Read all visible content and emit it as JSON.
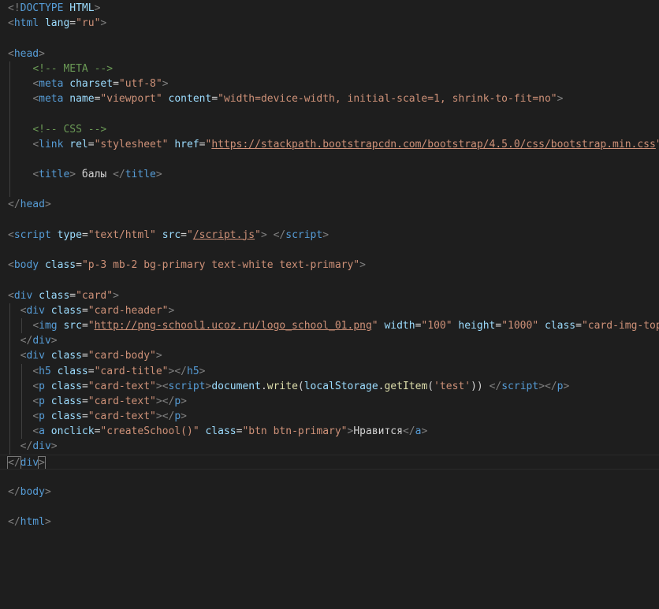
{
  "theme": {
    "background": "#1e1e1e",
    "colors": {
      "tag": "#569cd6",
      "attr": "#9cdcfe",
      "str": "#ce9178",
      "punc": "#808080",
      "text": "#d4d4d4",
      "comment": "#6a9955",
      "func": "#dcdcaa"
    }
  },
  "editor": {
    "active_line_index": 30,
    "lines": [
      {
        "guides": 0,
        "tokens": [
          [
            "punc",
            "<!"
          ],
          [
            "tag",
            "DOCTYPE"
          ],
          [
            "text",
            " "
          ],
          [
            "attr",
            "HTML"
          ],
          [
            "punc",
            ">"
          ]
        ]
      },
      {
        "guides": 0,
        "tokens": [
          [
            "punc",
            "<"
          ],
          [
            "tag",
            "html"
          ],
          [
            "text",
            " "
          ],
          [
            "attr",
            "lang"
          ],
          [
            "text",
            "="
          ],
          [
            "str",
            "\"ru\""
          ],
          [
            "punc",
            ">"
          ]
        ]
      },
      {
        "guides": 0,
        "tokens": []
      },
      {
        "guides": 0,
        "tokens": [
          [
            "punc",
            "<"
          ],
          [
            "tag",
            "head"
          ],
          [
            "punc",
            ">"
          ]
        ]
      },
      {
        "guides": 1,
        "tokens": [
          [
            "text",
            "    "
          ],
          [
            "comment",
            "<!-- META -->"
          ]
        ]
      },
      {
        "guides": 1,
        "tokens": [
          [
            "text",
            "    "
          ],
          [
            "punc",
            "<"
          ],
          [
            "tag",
            "meta"
          ],
          [
            "text",
            " "
          ],
          [
            "attr",
            "charset"
          ],
          [
            "text",
            "="
          ],
          [
            "str",
            "\"utf-8\""
          ],
          [
            "punc",
            ">"
          ]
        ]
      },
      {
        "guides": 1,
        "tokens": [
          [
            "text",
            "    "
          ],
          [
            "punc",
            "<"
          ],
          [
            "tag",
            "meta"
          ],
          [
            "text",
            " "
          ],
          [
            "attr",
            "name"
          ],
          [
            "text",
            "="
          ],
          [
            "str",
            "\"viewport\""
          ],
          [
            "text",
            " "
          ],
          [
            "attr",
            "content"
          ],
          [
            "text",
            "="
          ],
          [
            "str",
            "\"width=device-width, initial-scale=1, shrink-to-fit=no\""
          ],
          [
            "punc",
            ">"
          ]
        ]
      },
      {
        "guides": 1,
        "tokens": []
      },
      {
        "guides": 1,
        "tokens": [
          [
            "text",
            "    "
          ],
          [
            "comment",
            "<!-- CSS -->"
          ]
        ]
      },
      {
        "guides": 1,
        "tokens": [
          [
            "text",
            "    "
          ],
          [
            "punc",
            "<"
          ],
          [
            "tag",
            "link"
          ],
          [
            "text",
            " "
          ],
          [
            "attr",
            "rel"
          ],
          [
            "text",
            "="
          ],
          [
            "str",
            "\"stylesheet\""
          ],
          [
            "text",
            " "
          ],
          [
            "attr",
            "href"
          ],
          [
            "text",
            "="
          ],
          [
            "str",
            "\""
          ],
          [
            "str link",
            "https://stackpath.bootstrapcdn.com/bootstrap/4.5.0/css/bootstrap.min.css"
          ],
          [
            "str",
            "\""
          ],
          [
            "text",
            " >"
          ]
        ]
      },
      {
        "guides": 1,
        "tokens": []
      },
      {
        "guides": 1,
        "tokens": [
          [
            "text",
            "    "
          ],
          [
            "punc",
            "<"
          ],
          [
            "tag",
            "title"
          ],
          [
            "punc",
            ">"
          ],
          [
            "text",
            " балы "
          ],
          [
            "punc",
            "</"
          ],
          [
            "tag",
            "title"
          ],
          [
            "punc",
            ">"
          ]
        ]
      },
      {
        "guides": 1,
        "tokens": []
      },
      {
        "guides": 0,
        "tokens": [
          [
            "punc",
            "</"
          ],
          [
            "tag",
            "head"
          ],
          [
            "punc",
            ">"
          ]
        ]
      },
      {
        "guides": 0,
        "tokens": []
      },
      {
        "guides": 0,
        "tokens": [
          [
            "punc",
            "<"
          ],
          [
            "tag",
            "script"
          ],
          [
            "text",
            " "
          ],
          [
            "attr",
            "type"
          ],
          [
            "text",
            "="
          ],
          [
            "str",
            "\"text/html\""
          ],
          [
            "text",
            " "
          ],
          [
            "attr",
            "src"
          ],
          [
            "text",
            "="
          ],
          [
            "str",
            "\""
          ],
          [
            "str link",
            "/script.js"
          ],
          [
            "str",
            "\""
          ],
          [
            "punc",
            ">"
          ],
          [
            "text",
            " "
          ],
          [
            "punc",
            "</"
          ],
          [
            "tag",
            "script"
          ],
          [
            "punc",
            ">"
          ]
        ]
      },
      {
        "guides": 0,
        "tokens": []
      },
      {
        "guides": 0,
        "tokens": [
          [
            "punc",
            "<"
          ],
          [
            "tag",
            "body"
          ],
          [
            "text",
            " "
          ],
          [
            "attr",
            "class"
          ],
          [
            "text",
            "="
          ],
          [
            "str",
            "\"p-3 mb-2 bg-primary text-white text-primary\""
          ],
          [
            "punc",
            ">"
          ]
        ]
      },
      {
        "guides": 0,
        "tokens": []
      },
      {
        "guides": 0,
        "tokens": [
          [
            "punc",
            "<"
          ],
          [
            "tag",
            "div"
          ],
          [
            "text",
            " "
          ],
          [
            "attr",
            "class"
          ],
          [
            "text",
            "="
          ],
          [
            "str",
            "\"card\""
          ],
          [
            "punc",
            ">"
          ]
        ]
      },
      {
        "guides": 1,
        "tokens": [
          [
            "text",
            "  "
          ],
          [
            "punc",
            "<"
          ],
          [
            "tag",
            "div"
          ],
          [
            "text",
            " "
          ],
          [
            "attr",
            "class"
          ],
          [
            "text",
            "="
          ],
          [
            "str",
            "\"card-header\""
          ],
          [
            "punc",
            ">"
          ]
        ]
      },
      {
        "guides": 2,
        "tokens": [
          [
            "text",
            "    "
          ],
          [
            "punc",
            "<"
          ],
          [
            "tag",
            "img"
          ],
          [
            "text",
            " "
          ],
          [
            "attr",
            "src"
          ],
          [
            "text",
            "="
          ],
          [
            "str",
            "\""
          ],
          [
            "str link",
            "http://png-school1.ucoz.ru/logo_school_01.png"
          ],
          [
            "str",
            "\""
          ],
          [
            "text",
            " "
          ],
          [
            "attr",
            "width"
          ],
          [
            "text",
            "="
          ],
          [
            "str",
            "\"100\""
          ],
          [
            "text",
            " "
          ],
          [
            "attr",
            "height"
          ],
          [
            "text",
            "="
          ],
          [
            "str",
            "\"1000\""
          ],
          [
            "text",
            " "
          ],
          [
            "attr",
            "class"
          ],
          [
            "text",
            "="
          ],
          [
            "str",
            "\"card-img-top\""
          ],
          [
            "text",
            " >"
          ]
        ]
      },
      {
        "guides": 1,
        "tokens": [
          [
            "text",
            "  "
          ],
          [
            "punc",
            "</"
          ],
          [
            "tag",
            "div"
          ],
          [
            "punc",
            ">"
          ]
        ]
      },
      {
        "guides": 1,
        "tokens": [
          [
            "text",
            "  "
          ],
          [
            "punc",
            "<"
          ],
          [
            "tag",
            "div"
          ],
          [
            "text",
            " "
          ],
          [
            "attr",
            "class"
          ],
          [
            "text",
            "="
          ],
          [
            "str",
            "\"card-body\""
          ],
          [
            "punc",
            ">"
          ]
        ]
      },
      {
        "guides": 2,
        "tokens": [
          [
            "text",
            "    "
          ],
          [
            "punc",
            "<"
          ],
          [
            "tag",
            "h5"
          ],
          [
            "text",
            " "
          ],
          [
            "attr",
            "class"
          ],
          [
            "text",
            "="
          ],
          [
            "str",
            "\"card-title\""
          ],
          [
            "punc",
            ">"
          ],
          [
            "punc",
            "</"
          ],
          [
            "tag",
            "h5"
          ],
          [
            "punc",
            ">"
          ]
        ]
      },
      {
        "guides": 2,
        "tokens": [
          [
            "text",
            "    "
          ],
          [
            "punc",
            "<"
          ],
          [
            "tag",
            "p"
          ],
          [
            "text",
            " "
          ],
          [
            "attr",
            "class"
          ],
          [
            "text",
            "="
          ],
          [
            "str",
            "\"card-text\""
          ],
          [
            "punc",
            ">"
          ],
          [
            "punc",
            "<"
          ],
          [
            "tag",
            "script"
          ],
          [
            "punc",
            ">"
          ],
          [
            "attr",
            "document"
          ],
          [
            "text",
            "."
          ],
          [
            "func",
            "write"
          ],
          [
            "text",
            "("
          ],
          [
            "attr",
            "localStorage"
          ],
          [
            "text",
            "."
          ],
          [
            "func",
            "getItem"
          ],
          [
            "text",
            "("
          ],
          [
            "str",
            "'test'"
          ],
          [
            "text",
            "))"
          ],
          [
            "text",
            " "
          ],
          [
            "punc",
            "</"
          ],
          [
            "tag",
            "script"
          ],
          [
            "punc",
            ">"
          ],
          [
            "punc",
            "</"
          ],
          [
            "tag",
            "p"
          ],
          [
            "punc",
            ">"
          ]
        ]
      },
      {
        "guides": 2,
        "tokens": [
          [
            "text",
            "    "
          ],
          [
            "punc",
            "<"
          ],
          [
            "tag",
            "p"
          ],
          [
            "text",
            " "
          ],
          [
            "attr",
            "class"
          ],
          [
            "text",
            "="
          ],
          [
            "str",
            "\"card-text\""
          ],
          [
            "punc",
            ">"
          ],
          [
            "punc",
            "</"
          ],
          [
            "tag",
            "p"
          ],
          [
            "punc",
            ">"
          ]
        ]
      },
      {
        "guides": 2,
        "tokens": [
          [
            "text",
            "    "
          ],
          [
            "punc",
            "<"
          ],
          [
            "tag",
            "p"
          ],
          [
            "text",
            " "
          ],
          [
            "attr",
            "class"
          ],
          [
            "text",
            "="
          ],
          [
            "str",
            "\"card-text\""
          ],
          [
            "punc",
            ">"
          ],
          [
            "punc",
            "</"
          ],
          [
            "tag",
            "p"
          ],
          [
            "punc",
            ">"
          ]
        ]
      },
      {
        "guides": 2,
        "tokens": [
          [
            "text",
            "    "
          ],
          [
            "punc",
            "<"
          ],
          [
            "tag",
            "a"
          ],
          [
            "text",
            " "
          ],
          [
            "attr",
            "onclick"
          ],
          [
            "text",
            "="
          ],
          [
            "str",
            "\"createSchool()\""
          ],
          [
            "text",
            " "
          ],
          [
            "attr",
            "class"
          ],
          [
            "text",
            "="
          ],
          [
            "str",
            "\"btn btn-primary\""
          ],
          [
            "punc",
            ">"
          ],
          [
            "text",
            "Нравится"
          ],
          [
            "punc",
            "</"
          ],
          [
            "tag",
            "a"
          ],
          [
            "punc",
            ">"
          ]
        ]
      },
      {
        "guides": 1,
        "tokens": [
          [
            "text",
            "  "
          ],
          [
            "punc",
            "</"
          ],
          [
            "tag",
            "div"
          ],
          [
            "punc",
            ">"
          ]
        ]
      },
      {
        "guides": 0,
        "tokens": [
          [
            "punc bracket",
            "</"
          ],
          [
            "tag",
            "div"
          ],
          [
            "punc bracket",
            ">"
          ]
        ]
      },
      {
        "guides": 0,
        "tokens": []
      },
      {
        "guides": 0,
        "tokens": [
          [
            "punc",
            "</"
          ],
          [
            "tag",
            "body"
          ],
          [
            "punc",
            ">"
          ]
        ]
      },
      {
        "guides": 0,
        "tokens": []
      },
      {
        "guides": 0,
        "tokens": [
          [
            "punc",
            "</"
          ],
          [
            "tag",
            "html"
          ],
          [
            "punc",
            ">"
          ]
        ]
      }
    ]
  }
}
